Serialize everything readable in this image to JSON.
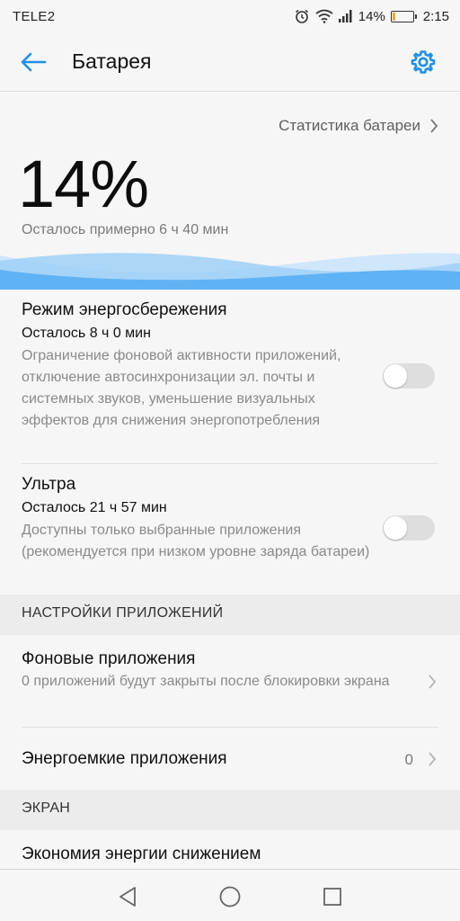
{
  "status_bar": {
    "carrier": "TELE2",
    "battery_percent": "14%",
    "time": "2:15",
    "battery_level": 0.14,
    "battery_color": "#f5a623"
  },
  "app_bar": {
    "title": "Батарея",
    "back_icon": "arrow-left-icon",
    "settings_icon": "gear-icon",
    "accent_color": "#1f8fe6"
  },
  "hero": {
    "stats_link": "Статистика батареи",
    "percent": "14%",
    "remaining": "Осталось примерно 6 ч 40 мин"
  },
  "power_saving": {
    "title": "Режим энергосбережения",
    "subtitle": "Осталось 8 ч 0 мин",
    "description": "Ограничение фоновой активности приложений, отключение автосинхронизации эл. почты и системных звуков, уменьшение визуальных эффектов для снижения энергопотребления",
    "enabled": false
  },
  "ultra": {
    "title": "Ультра",
    "subtitle": "Осталось 21 ч 57 мин",
    "description": "Доступны только выбранные приложения (рекомендуется при низком уровне заряда батареи)",
    "enabled": false
  },
  "app_settings": {
    "header": "НАСТРОЙКИ ПРИЛОЖЕНИЙ",
    "background_apps": {
      "title": "Фоновые приложения",
      "description": "0 приложений будут закрыты после блокировки экрана"
    },
    "power_intensive": {
      "title": "Энергоемкие приложения",
      "count": "0"
    }
  },
  "screen": {
    "header": "ЭКРАН",
    "item_title": "Экономия энергии снижением"
  },
  "nav_bar": {
    "back_icon": "triangle-back-icon",
    "home_icon": "circle-home-icon",
    "recents_icon": "square-recents-icon"
  }
}
